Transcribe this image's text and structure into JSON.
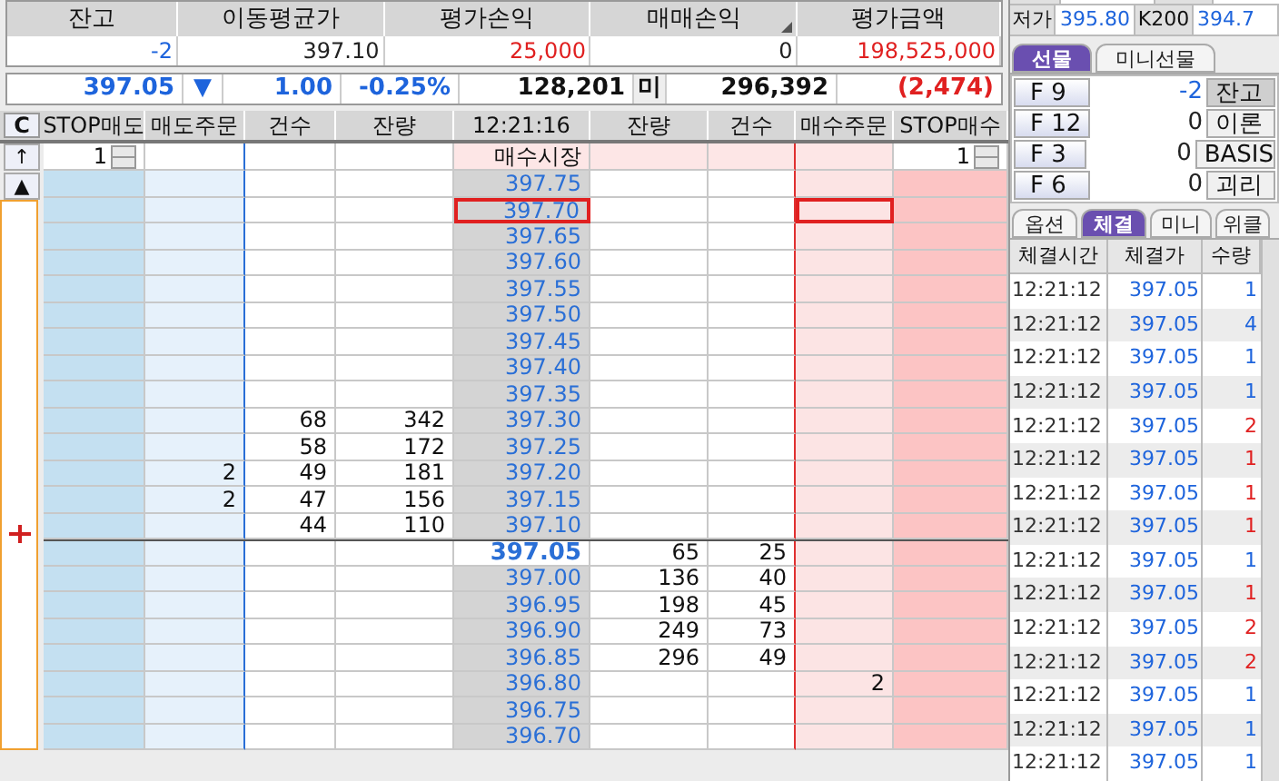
{
  "summary": {
    "columns": [
      "잔고",
      "이동평균가",
      "평가손익",
      "매매손익",
      "평가금액"
    ],
    "values": [
      {
        "text": "-2",
        "color": "#1e64dc"
      },
      {
        "text": "397.10",
        "color": "#222222"
      },
      {
        "text": "25,000",
        "color": "#e02020"
      },
      {
        "text": "0",
        "color": "#222222"
      },
      {
        "text": "198,525,000",
        "color": "#e02020"
      }
    ]
  },
  "quote": {
    "price": "397.05",
    "arrow": "▼",
    "change": "1.00",
    "rate": "-0.25%",
    "volume": "128,201",
    "oi_label": "미",
    "open_interest": "296,392",
    "oi_change": "(2,474)"
  },
  "ladder": {
    "clear_button": "C",
    "columns": [
      "STOP매도",
      "매도주문",
      "건수",
      "잔량",
      "12:21:16",
      "잔량",
      "건수",
      "매수주문",
      "STOP매수"
    ],
    "up_button": "↑",
    "top_button": "▲",
    "stop_sell": "1",
    "stop_buy": "1",
    "market_label": "매수시장",
    "rows": [
      {
        "price": "397.75",
        "selected": false,
        "current": false
      },
      {
        "price": "397.70",
        "selected": true,
        "current": false
      },
      {
        "price": "397.65",
        "selected": false,
        "current": false
      },
      {
        "price": "397.60",
        "selected": false,
        "current": false
      },
      {
        "price": "397.55",
        "selected": false,
        "current": false
      },
      {
        "price": "397.50",
        "selected": false,
        "current": false
      },
      {
        "price": "397.45",
        "selected": false,
        "current": false
      },
      {
        "price": "397.40",
        "selected": false,
        "current": false
      },
      {
        "price": "397.35",
        "selected": false,
        "current": false
      },
      {
        "price": "397.30",
        "selected": false,
        "current": false,
        "sell_count": "68",
        "sell_qty": "342"
      },
      {
        "price": "397.25",
        "selected": false,
        "current": false,
        "sell_count": "58",
        "sell_qty": "172"
      },
      {
        "price": "397.20",
        "selected": false,
        "current": false,
        "sell_order": "2",
        "sell_count": "49",
        "sell_qty": "181"
      },
      {
        "price": "397.15",
        "selected": false,
        "current": false,
        "sell_order": "2",
        "sell_count": "47",
        "sell_qty": "156"
      },
      {
        "price": "397.10",
        "selected": false,
        "current": false,
        "sell_count": "44",
        "sell_qty": "110"
      },
      {
        "price": "397.05",
        "selected": false,
        "current": true,
        "buy_qty": "65",
        "buy_count": "25"
      },
      {
        "price": "397.00",
        "selected": false,
        "current": false,
        "buy_qty": "136",
        "buy_count": "40"
      },
      {
        "price": "396.95",
        "selected": false,
        "current": false,
        "buy_qty": "198",
        "buy_count": "45"
      },
      {
        "price": "396.90",
        "selected": false,
        "current": false,
        "buy_qty": "249",
        "buy_count": "73"
      },
      {
        "price": "396.85",
        "selected": false,
        "current": false,
        "buy_qty": "296",
        "buy_count": "49"
      },
      {
        "price": "396.80",
        "selected": false,
        "current": false,
        "buy_order": "2"
      },
      {
        "price": "396.75",
        "selected": false,
        "current": false
      },
      {
        "price": "396.70",
        "selected": false,
        "current": false
      }
    ]
  },
  "side": {
    "quote_row": [
      "저가",
      "395.80",
      "K200",
      "394.7"
    ],
    "tabs": [
      {
        "label": "선물",
        "selected": true
      },
      {
        "label": "미니선물",
        "selected": false
      }
    ],
    "futures": [
      {
        "label": "F 9",
        "value": "-2",
        "action": "잔고"
      },
      {
        "label": "F 12",
        "value": "0",
        "action": "이론"
      },
      {
        "label": "F 3",
        "value": "0",
        "action": "BASIS"
      },
      {
        "label": "F 6",
        "value": "0",
        "action": "괴리"
      }
    ],
    "tabs2": [
      {
        "label": "옵션",
        "selected": false
      },
      {
        "label": "체결",
        "selected": true
      },
      {
        "label": "미니",
        "selected": false
      },
      {
        "label": "위클",
        "selected": false
      }
    ],
    "trade_columns": [
      "체결시간",
      "체결가",
      "수량"
    ],
    "trades": [
      {
        "time": "12:21:12",
        "price": "397.05",
        "qty": "1",
        "color": "#1e64dc"
      },
      {
        "time": "12:21:12",
        "price": "397.05",
        "qty": "4",
        "color": "#1e64dc"
      },
      {
        "time": "12:21:12",
        "price": "397.05",
        "qty": "1",
        "color": "#1e64dc"
      },
      {
        "time": "12:21:12",
        "price": "397.05",
        "qty": "1",
        "color": "#1e64dc"
      },
      {
        "time": "12:21:12",
        "price": "397.05",
        "qty": "2",
        "color": "#e02020"
      },
      {
        "time": "12:21:12",
        "price": "397.05",
        "qty": "1",
        "color": "#e02020"
      },
      {
        "time": "12:21:12",
        "price": "397.05",
        "qty": "1",
        "color": "#e02020"
      },
      {
        "time": "12:21:12",
        "price": "397.05",
        "qty": "1",
        "color": "#e02020"
      },
      {
        "time": "12:21:12",
        "price": "397.05",
        "qty": "1",
        "color": "#1e64dc"
      },
      {
        "time": "12:21:12",
        "price": "397.05",
        "qty": "1",
        "color": "#e02020"
      },
      {
        "time": "12:21:12",
        "price": "397.05",
        "qty": "2",
        "color": "#e02020"
      },
      {
        "time": "12:21:12",
        "price": "397.05",
        "qty": "2",
        "color": "#e02020"
      },
      {
        "time": "12:21:12",
        "price": "397.05",
        "qty": "1",
        "color": "#1e64dc"
      },
      {
        "time": "12:21:12",
        "price": "397.05",
        "qty": "1",
        "color": "#1e64dc"
      },
      {
        "time": "12:21:12",
        "price": "397.05",
        "qty": "1",
        "color": "#1e64dc"
      }
    ]
  }
}
